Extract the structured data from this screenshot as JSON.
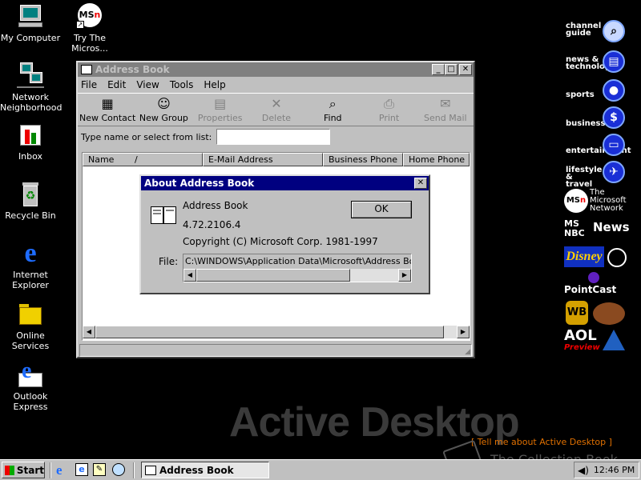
{
  "desktop": {
    "icons": [
      {
        "label": "My Computer",
        "icon": "computer-icon"
      },
      {
        "label": "Try The Micros...",
        "icon": "msn-icon"
      },
      {
        "label": "Network Neighborhood",
        "icon": "network-icon"
      },
      {
        "label": "Inbox",
        "icon": "inbox-icon"
      },
      {
        "label": "Recycle Bin",
        "icon": "recycle-bin-icon"
      },
      {
        "label": "Internet Explorer",
        "icon": "ie-icon"
      },
      {
        "label": "Online Services",
        "icon": "folder-icon"
      },
      {
        "label": "Outlook Express",
        "icon": "outlook-express-icon"
      }
    ],
    "wallpaper_text": "Active Desktop",
    "tell_me_link": "[ Tell me about Active Desktop ]",
    "watermark": "The Collection Book"
  },
  "channel_bar": {
    "channel_guide": "channel guide",
    "news_technology": "news & technology",
    "sports": "sports",
    "business": "business",
    "entertainment": "entertainment",
    "lifestyle_travel": "lifestyle & travel",
    "msn": "The Microsoft Network",
    "msnbc": "News",
    "disney": "Disney",
    "pointcast": "PointCast",
    "warner": "WB",
    "aol": "AOL",
    "aol_preview": "Preview"
  },
  "address_book": {
    "title": "Address Book",
    "menu": [
      "File",
      "Edit",
      "View",
      "Tools",
      "Help"
    ],
    "toolbar": [
      {
        "label": "New Contact",
        "enabled": true,
        "icon": "new-contact-icon"
      },
      {
        "label": "New Group",
        "enabled": true,
        "icon": "new-group-icon"
      },
      {
        "label": "Properties",
        "enabled": false,
        "icon": "properties-icon"
      },
      {
        "label": "Delete",
        "enabled": false,
        "icon": "delete-icon"
      },
      {
        "label": "Find",
        "enabled": true,
        "icon": "find-icon"
      },
      {
        "label": "Print",
        "enabled": false,
        "icon": "print-icon"
      },
      {
        "label": "Send Mail",
        "enabled": false,
        "icon": "send-mail-icon"
      }
    ],
    "search_label": "Type name or select from list:",
    "search_value": "",
    "columns": [
      "Name",
      "E-Mail Address",
      "Business Phone",
      "Home Phone"
    ],
    "sort_indicator": "/"
  },
  "about_dialog": {
    "title": "About Address Book",
    "product": "Address Book",
    "version": "4.72.2106.4",
    "copyright": "Copyright (C) Microsoft Corp. 1981-1997",
    "file_label": "File:",
    "file_path": "C:\\WINDOWS\\Application Data\\Microsoft\\Address Book\\",
    "ok": "OK"
  },
  "taskbar": {
    "start": "Start",
    "task": "Address Book",
    "clock": "12:46 PM"
  }
}
